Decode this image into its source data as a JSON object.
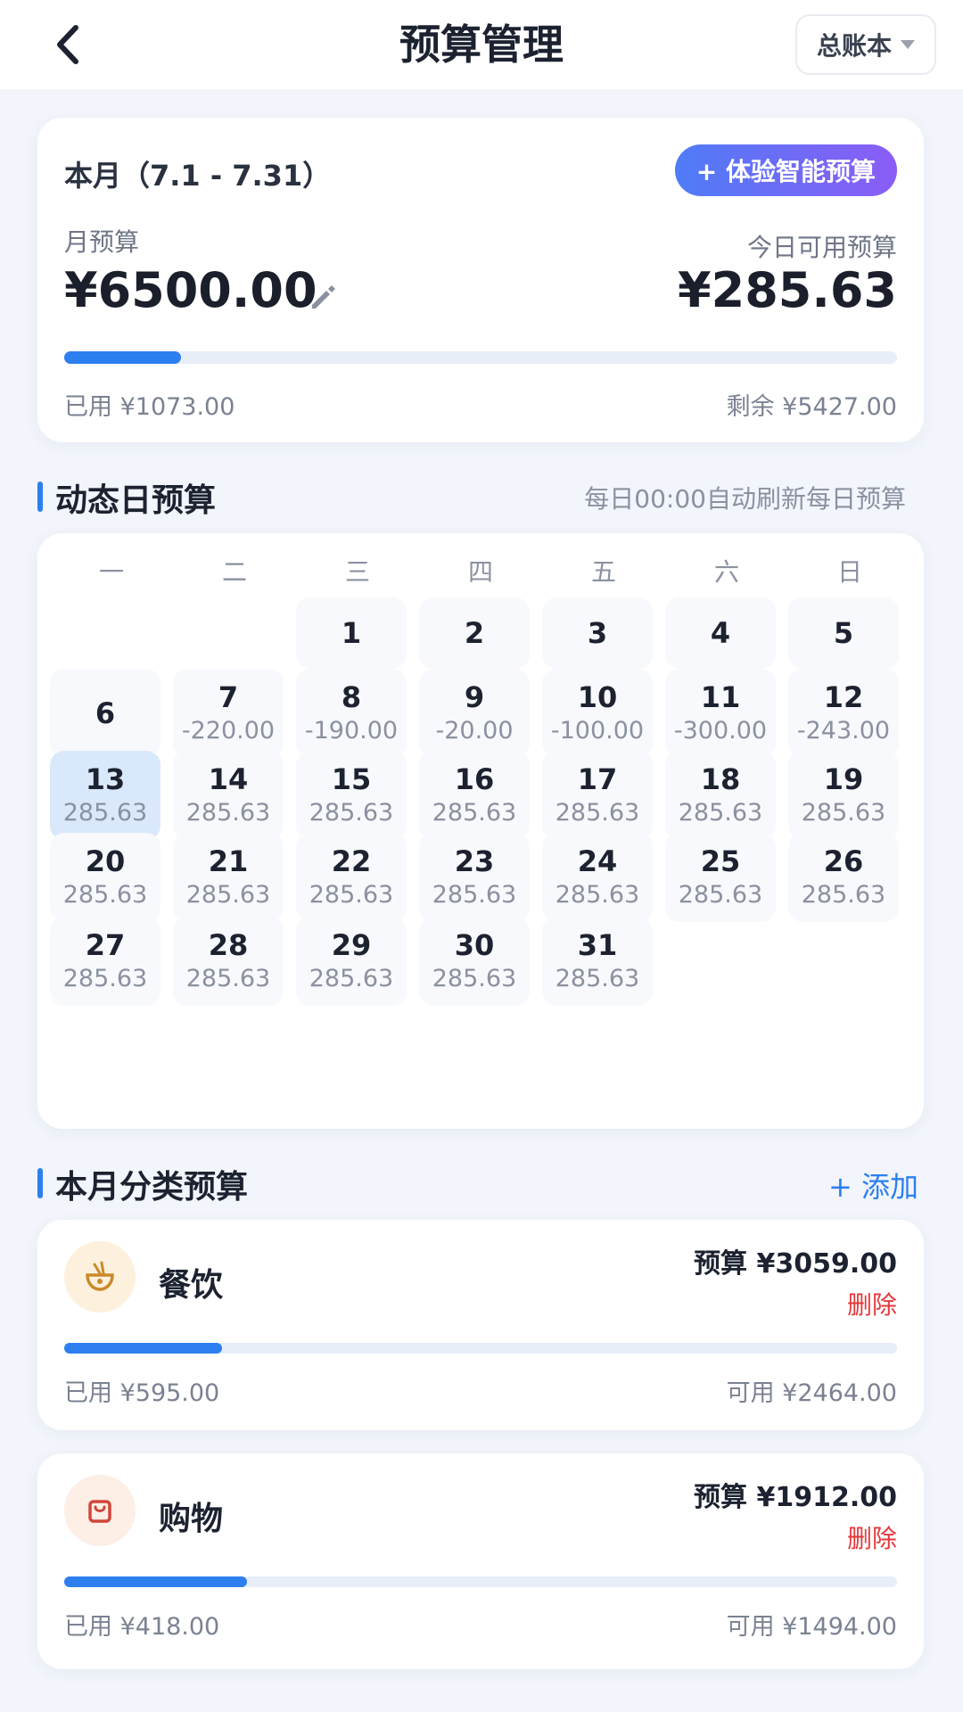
{
  "header": {
    "title": "预算管理",
    "ledger": "总账本"
  },
  "summary": {
    "period": "本月（7.1 - 7.31）",
    "smart_button": "+ 体验智能预算",
    "month_label": "月预算",
    "month_amount": "¥6500.00",
    "today_label": "今日可用预算",
    "today_amount": "¥285.63",
    "progress": 0.14,
    "used": "已用 ¥1073.00",
    "remaining": "剩余 ¥5427.00"
  },
  "daily": {
    "title": "动态日预算",
    "note": "每日00:00自动刷新每日预算",
    "weekdays": [
      "一",
      "二",
      "三",
      "四",
      "五",
      "六",
      "日"
    ],
    "days": [
      {
        "d": "1",
        "v": ""
      },
      {
        "d": "2",
        "v": ""
      },
      {
        "d": "3",
        "v": ""
      },
      {
        "d": "4",
        "v": ""
      },
      {
        "d": "5",
        "v": ""
      },
      {
        "d": "6",
        "v": ""
      },
      {
        "d": "7",
        "v": "-220.00"
      },
      {
        "d": "8",
        "v": "-190.00"
      },
      {
        "d": "9",
        "v": "-20.00"
      },
      {
        "d": "10",
        "v": "-100.00"
      },
      {
        "d": "11",
        "v": "-300.00"
      },
      {
        "d": "12",
        "v": "-243.00"
      },
      {
        "d": "13",
        "v": "285.63"
      },
      {
        "d": "14",
        "v": "285.63"
      },
      {
        "d": "15",
        "v": "285.63"
      },
      {
        "d": "16",
        "v": "285.63"
      },
      {
        "d": "17",
        "v": "285.63"
      },
      {
        "d": "18",
        "v": "285.63"
      },
      {
        "d": "19",
        "v": "285.63"
      },
      {
        "d": "20",
        "v": "285.63"
      },
      {
        "d": "21",
        "v": "285.63"
      },
      {
        "d": "22",
        "v": "285.63"
      },
      {
        "d": "23",
        "v": "285.63"
      },
      {
        "d": "24",
        "v": "285.63"
      },
      {
        "d": "25",
        "v": "285.63"
      },
      {
        "d": "26",
        "v": "285.63"
      },
      {
        "d": "27",
        "v": "285.63"
      },
      {
        "d": "28",
        "v": "285.63"
      },
      {
        "d": "29",
        "v": "285.63"
      },
      {
        "d": "30",
        "v": "285.63"
      },
      {
        "d": "31",
        "v": "285.63"
      }
    ],
    "today": "13"
  },
  "categories": {
    "title": "本月分类预算",
    "add": "+ 添加",
    "items": [
      {
        "name": "餐饮",
        "icon": "noodle-bowl-icon",
        "budget": "预算 ¥3059.00",
        "delete": "删除",
        "progress": 0.19,
        "used": "已用 ¥595.00",
        "available": "可用 ¥2464.00",
        "icon_bg": "#fdf1dd",
        "icon_color": "#c98a2b"
      },
      {
        "name": "购物",
        "icon": "shopping-bag-icon",
        "budget": "预算 ¥1912.00",
        "delete": "删除",
        "progress": 0.22,
        "used": "已用 ¥418.00",
        "available": "可用 ¥1494.00",
        "icon_bg": "#fdeee6",
        "icon_color": "#d2453a"
      }
    ]
  }
}
